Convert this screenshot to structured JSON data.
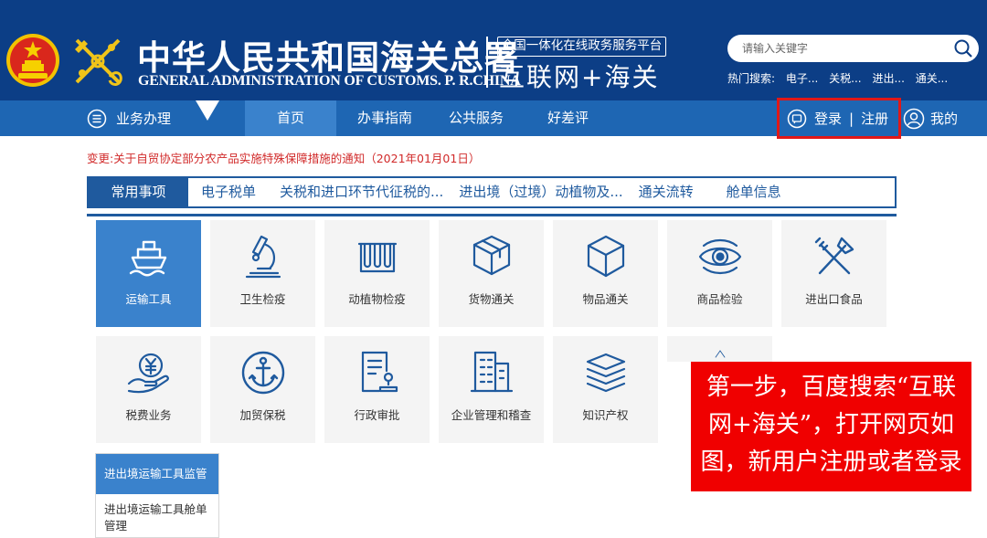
{
  "header": {
    "title_cn": "中华人民共和国海关总署",
    "title_en": "GENERAL ADMINISTRATION OF CUSTOMS. P. R.CHINA",
    "platform_tag": "全国一体化在线政务服务平台",
    "platform_name": "互联网+海关",
    "search_placeholder": "请输入关键字",
    "hot_label": "热门搜索:",
    "hot_items": [
      "电子...",
      "关税...",
      "进出...",
      "通关..."
    ]
  },
  "nav": {
    "menu_label": "业务办理",
    "home": "首页",
    "links": [
      "办事指南",
      "公共服务",
      "好差评"
    ],
    "login": "登录",
    "separator": "|",
    "register": "注册",
    "mine": "我的"
  },
  "notice": "变更:关于自贸协定部分农产品实施特殊保障措施的通知（2021年01月01日）",
  "tabs": [
    "常用事项",
    "电子税单",
    "关税和进口环节代征税的...",
    "进出境（过境）动植物及...",
    "通关流转",
    "舱单信息"
  ],
  "tiles": [
    {
      "label": "运输工具",
      "icon": "ship-icon"
    },
    {
      "label": "卫生检疫",
      "icon": "microscope-icon"
    },
    {
      "label": "动植物检疫",
      "icon": "test-tubes-icon"
    },
    {
      "label": "货物通关",
      "icon": "package-icon"
    },
    {
      "label": "物品通关",
      "icon": "cube-icon"
    },
    {
      "label": "商品检验",
      "icon": "eye-icon"
    },
    {
      "label": "进出口食品",
      "icon": "fork-knife-icon"
    },
    {
      "label": "税费业务",
      "icon": "yen-hand-icon"
    },
    {
      "label": "加贸保税",
      "icon": "anchor-icon"
    },
    {
      "label": "行政审批",
      "icon": "approval-doc-icon"
    },
    {
      "label": "企业管理和稽查",
      "icon": "building-icon"
    },
    {
      "label": "知识产权",
      "icon": "layers-icon"
    }
  ],
  "submenu": {
    "header": "进出境运输工具监管",
    "item": "进出境运输工具舱单管理"
  },
  "overlay_text": "第一步，百度搜索“互联网+海关”，打开网页如图，新用户注册或者登录",
  "colors": {
    "header_bg": "#0c3e86",
    "nav_bg": "#1e66b3",
    "accent": "#3a82cc",
    "tab_border": "#1f5a9e",
    "notice_red": "#d12a2a",
    "overlay_red": "#f00000"
  }
}
